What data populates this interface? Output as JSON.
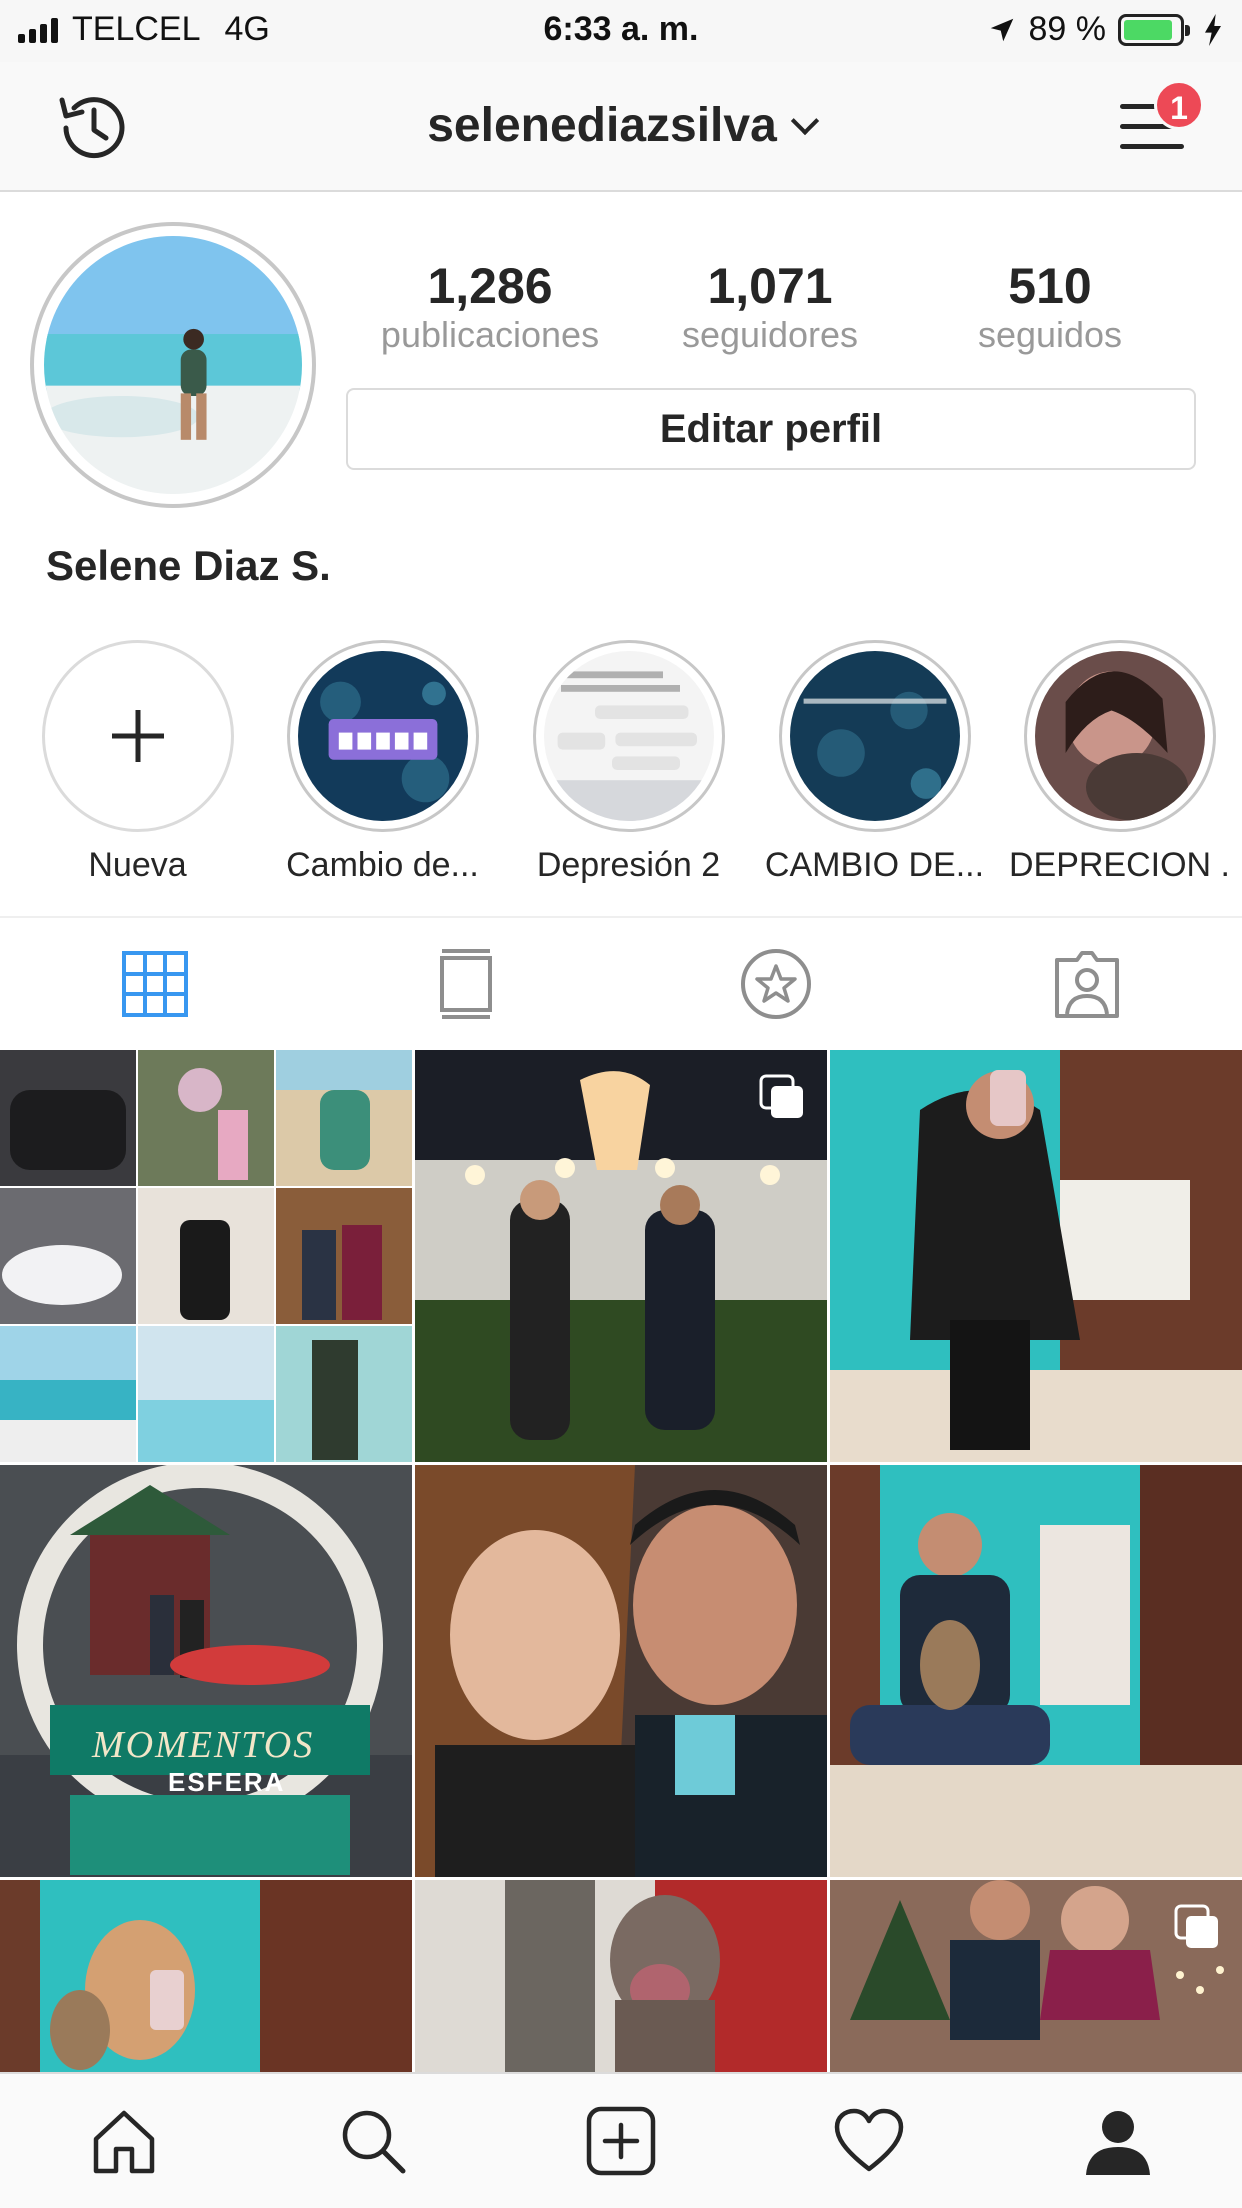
{
  "status_bar": {
    "carrier": "TELCEL",
    "network": "4G",
    "time": "6:33 a. m.",
    "battery": "89 %",
    "battery_level": 0.89,
    "battery_color": "#4cd964"
  },
  "header": {
    "username": "selenediazsilva",
    "history_icon": "history-icon",
    "menu_icon": "hamburger-menu-icon",
    "notification_count": "1",
    "badge_color": "#ed4956"
  },
  "profile": {
    "stats": [
      {
        "value": "1,286",
        "label": "publicaciones"
      },
      {
        "value": "1,071",
        "label": "seguidores"
      },
      {
        "value": "510",
        "label": "seguidos"
      }
    ],
    "edit_button": "Editar perfil",
    "full_name": "Selene Diaz S."
  },
  "highlights": [
    {
      "label": "Nueva"
    },
    {
      "label": "Cambio de..."
    },
    {
      "label": "Depresión 2"
    },
    {
      "label": "CAMBIO DE..."
    },
    {
      "label": "DEPRECION ."
    }
  ],
  "tabs": [
    {
      "icon": "grid-icon",
      "active": true
    },
    {
      "icon": "feed-list-icon",
      "active": false
    },
    {
      "icon": "saved-star-icon",
      "active": false
    },
    {
      "icon": "tagged-person-icon",
      "active": false
    }
  ],
  "accent_color": "#3897f0",
  "grid_posts": {
    "sign_line_1": "MOMENTOS",
    "sign_line_2": "ESFERA"
  },
  "bottom_nav": [
    {
      "icon": "home-icon"
    },
    {
      "icon": "search-icon"
    },
    {
      "icon": "new-post-icon"
    },
    {
      "icon": "activity-heart-icon"
    },
    {
      "icon": "profile-icon"
    }
  ]
}
